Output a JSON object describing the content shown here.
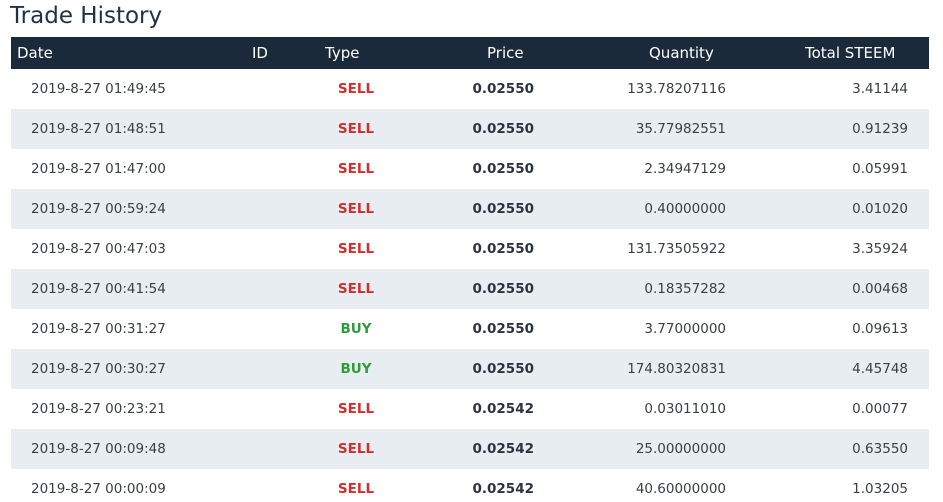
{
  "title": "Trade History",
  "columns": {
    "date": "Date",
    "id": "ID",
    "type": "Type",
    "price": "Price",
    "quantity": "Quantity",
    "total": "Total STEEM"
  },
  "rows": [
    {
      "date": "2019-8-27 01:49:45",
      "type": "SELL",
      "price": "0.02550",
      "quantity": "133.78207116",
      "total": "3.41144"
    },
    {
      "date": "2019-8-27 01:48:51",
      "type": "SELL",
      "price": "0.02550",
      "quantity": "35.77982551",
      "total": "0.91239"
    },
    {
      "date": "2019-8-27 01:47:00",
      "type": "SELL",
      "price": "0.02550",
      "quantity": "2.34947129",
      "total": "0.05991"
    },
    {
      "date": "2019-8-27 00:59:24",
      "type": "SELL",
      "price": "0.02550",
      "quantity": "0.40000000",
      "total": "0.01020"
    },
    {
      "date": "2019-8-27 00:47:03",
      "type": "SELL",
      "price": "0.02550",
      "quantity": "131.73505922",
      "total": "3.35924"
    },
    {
      "date": "2019-8-27 00:41:54",
      "type": "SELL",
      "price": "0.02550",
      "quantity": "0.18357282",
      "total": "0.00468"
    },
    {
      "date": "2019-8-27 00:31:27",
      "type": "BUY",
      "price": "0.02550",
      "quantity": "3.77000000",
      "total": "0.09613"
    },
    {
      "date": "2019-8-27 00:30:27",
      "type": "BUY",
      "price": "0.02550",
      "quantity": "174.80320831",
      "total": "4.45748"
    },
    {
      "date": "2019-8-27 00:23:21",
      "type": "SELL",
      "price": "0.02542",
      "quantity": "0.03011010",
      "total": "0.00077"
    },
    {
      "date": "2019-8-27 00:09:48",
      "type": "SELL",
      "price": "0.02542",
      "quantity": "25.00000000",
      "total": "0.63550"
    },
    {
      "date": "2019-8-27 00:00:09",
      "type": "SELL",
      "price": "0.02542",
      "quantity": "40.60000000",
      "total": "1.03205"
    }
  ],
  "colors": {
    "header_bg": "#1b2a3a",
    "alt_row_bg": "#e8edf1",
    "sell": "#d32d2d",
    "buy": "#2f9b3a"
  }
}
